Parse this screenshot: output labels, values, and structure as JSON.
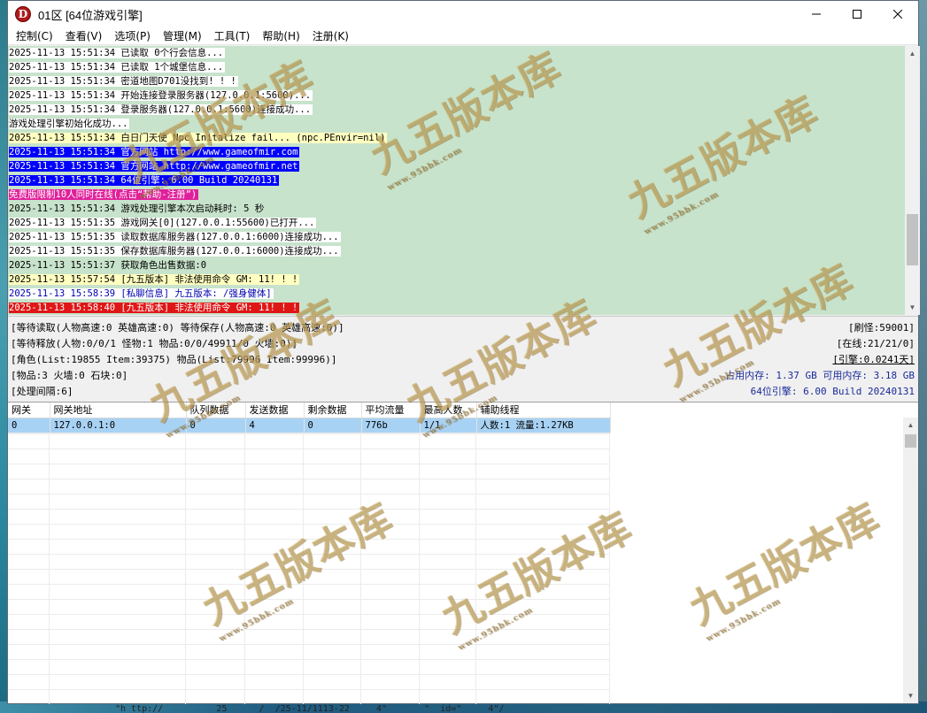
{
  "window": {
    "icon_letter": "D",
    "title": "01区 [64位游戏引擎]"
  },
  "menu": [
    "控制(C)",
    "查看(V)",
    "选项(P)",
    "管理(M)",
    "工具(T)",
    "帮助(H)",
    "注册(K)"
  ],
  "log": [
    {
      "text": "2025-11-13 15:51:34 已读取 0个行会信息...",
      "style": "hl-white"
    },
    {
      "text": "2025-11-13 15:51:34 已读取 1个城堡信息...",
      "style": "hl-white"
    },
    {
      "text": "2025-11-13 15:51:34 密道地图D701没找到! ! !",
      "style": "hl-white"
    },
    {
      "text": "2025-11-13 15:51:34 开始连接登录服务器(127.0.0.1:5600)...",
      "style": "hl-white"
    },
    {
      "text": "2025-11-13 15:51:34 登录服务器(127.0.0.1:5600)连接成功...",
      "style": "hl-white"
    },
    {
      "text": "游戏处理引擎初始化成功...",
      "style": "hl-white"
    },
    {
      "text": "2025-11-13 15:51:34 白日门天使 Npc Initalize fail... (npc.PEnvir=nil)",
      "style": "hl-yellow"
    },
    {
      "text": "2025-11-13 15:51:34 官方网站 http://www.gameofmir.com",
      "style": "hl-blue"
    },
    {
      "text": "2025-11-13 15:51:34 官方网站 http://www.gameofmir.net",
      "style": "hl-blue"
    },
    {
      "text": "2025-11-13 15:51:34 64位引擎: 6.00 Build 20240131",
      "style": "hl-blue"
    },
    {
      "text": "免费版限制10人同时在线(点击“帮助-注册”)",
      "style": "hl-pink"
    },
    {
      "text": "2025-11-13 15:51:34 游戏处理引擎本次启动耗时: 5 秒",
      "style": "plain"
    },
    {
      "text": "2025-11-13 15:51:35 游戏网关[0](127.0.0.1:55600)已打开...",
      "style": "hl-white"
    },
    {
      "text": "2025-11-13 15:51:35 读取数据库服务器(127.0.0.1:6000)连接成功...",
      "style": "hl-white"
    },
    {
      "text": "2025-11-13 15:51:35 保存数据库服务器(127.0.0.1:6000)连接成功...",
      "style": "hl-white"
    },
    {
      "text": "2025-11-13 15:51:37 获取角色出售数据:0",
      "style": "plain"
    },
    {
      "text": "2025-11-13 15:57:54 [九五版本] 非法使用命令 GM: 11! ! !",
      "style": "hl-yellow"
    },
    {
      "text": "2025-11-13 15:58:39 [私聊信息] 九五版本: /强身健体]",
      "style": "hl-wblue"
    },
    {
      "text": "2025-11-13 15:58:40 [九五版本] 非法使用命令 GM: 11! ! !",
      "style": "hl-red"
    }
  ],
  "status": {
    "row1_left": "[等待读取(人物高速:0 英雄高速:0) 等待保存(人物高速:0 英雄高速:0)]",
    "row2_left": "[等待释放(人物:0/0/1 怪物:1 物品:0/0/49911/0 火墙:0)]",
    "row3_left": "[角色(List:19855 Item:39375) 物品(List:79996 Item:99996)]",
    "row4_left": "[物品:3 火墙:0 石块:0]",
    "row5_left": "[处理间隔:6]",
    "refresh": "[刷怪:59001]",
    "online": "[在线:21/21/0]",
    "engine_time": "[引擎:0.0241天]",
    "memory": "占用内存: 1.37 GB 可用内存: 3.18 GB",
    "engine_version": "64位引擎: 6.00 Build 20240131"
  },
  "grid": {
    "columns": [
      "网关",
      "网关地址",
      "队列数据",
      "发送数据",
      "剩余数据",
      "平均流量",
      "最高人数",
      "辅助线程"
    ],
    "rows": [
      [
        "0",
        "127.0.0.1:0",
        "0",
        "4",
        "0",
        "776b",
        "1/1",
        "人数:1 流量:1.27KB"
      ]
    ]
  },
  "watermark": {
    "text": "九五版本库",
    "sub": "www.95bbk.com"
  },
  "taskbar_tail": "\"h ttp://          25      /  /25-11/1113-22     4\"       \"  id=\"     4\"/"
}
